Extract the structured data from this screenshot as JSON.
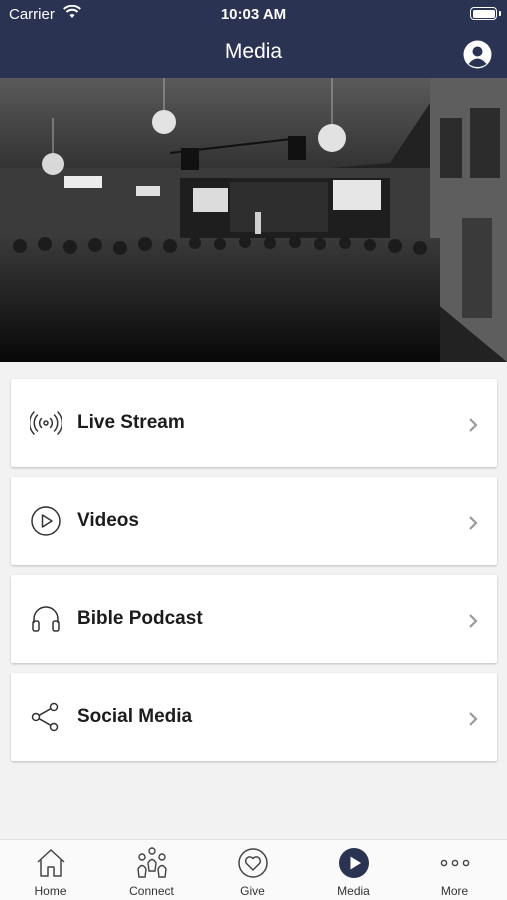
{
  "status_bar": {
    "carrier": "Carrier",
    "time": "10:03 AM"
  },
  "nav": {
    "title": "Media",
    "profile_icon": "user-circle-icon"
  },
  "colors": {
    "header_bg": "#2b3352",
    "card_bg": "#ffffff",
    "page_bg": "#f2f2f2",
    "active_tab": "#2b3352"
  },
  "menu": {
    "items": [
      {
        "label": "Live Stream",
        "icon": "broadcast-icon"
      },
      {
        "label": "Videos",
        "icon": "play-circle-icon"
      },
      {
        "label": "Bible Podcast",
        "icon": "headphones-icon"
      },
      {
        "label": "Social Media",
        "icon": "share-icon"
      }
    ]
  },
  "tabbar": {
    "active": "Media",
    "tabs": [
      {
        "label": "Home",
        "icon": "home-icon"
      },
      {
        "label": "Connect",
        "icon": "people-icon"
      },
      {
        "label": "Give",
        "icon": "heart-circle-icon"
      },
      {
        "label": "Media",
        "icon": "play-circle-filled-icon"
      },
      {
        "label": "More",
        "icon": "more-dots-icon"
      }
    ]
  }
}
